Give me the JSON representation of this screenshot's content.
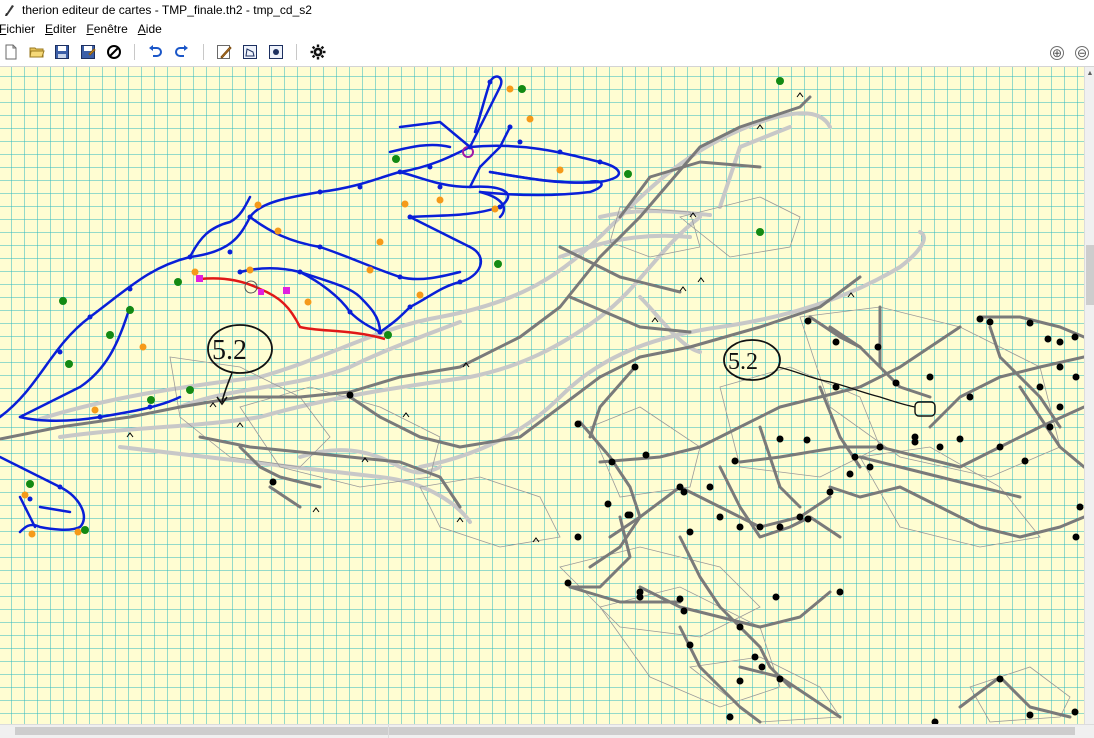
{
  "window": {
    "title": "therion editeur de cartes - TMP_finale.th2 - tmp_cd_s2"
  },
  "menu": {
    "items": [
      {
        "mnemonic": "F",
        "rest": "ichier"
      },
      {
        "mnemonic": "E",
        "rest": "diter"
      },
      {
        "mnemonic": "F",
        "rest": "enêtre"
      },
      {
        "mnemonic": "A",
        "rest": "ide"
      }
    ]
  },
  "toolbar": {
    "buttons": [
      "new-file-icon",
      "open-folder-icon",
      "save-icon",
      "save-as-icon",
      "close-icon",
      "undo-icon",
      "redo-icon",
      "edit-pencil-icon",
      "area-icon",
      "point-icon",
      "settings-gear-icon"
    ]
  },
  "zoom": {
    "in_symbol": "⊕",
    "out_symbol": "⊖"
  },
  "map": {
    "labels": [
      {
        "text": "5.2"
      },
      {
        "text": "5.2"
      }
    ],
    "colors": {
      "background": "#fffdd2",
      "grid": "#2bb8c0",
      "blue_path": "#0a1fd8",
      "red_path": "#e01818",
      "gray_path": "#808080",
      "light_path": "#c8c8c8",
      "station": "#000000",
      "green_point": "#138a13",
      "orange_marker": "#f59a1a",
      "magenta": "#e020e0"
    }
  }
}
